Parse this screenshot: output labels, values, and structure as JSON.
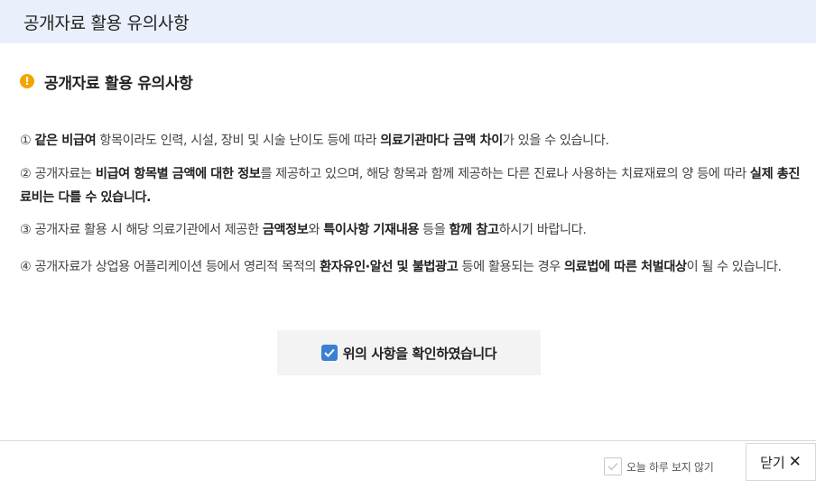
{
  "header": {
    "title": "공개자료 활용 유의사항"
  },
  "section": {
    "title": "공개자료 활용 유의사항",
    "icon": "alert-icon"
  },
  "notices": [
    {
      "marker": "①",
      "parts": [
        {
          "t": " "
        },
        {
          "t": "같은 비급여",
          "b": true
        },
        {
          "t": " 항목이라도 인력, 시설, 장비 및 시술 난이도 등에 따라 "
        },
        {
          "t": "의료기관마다 금액 차이",
          "b": true
        },
        {
          "t": "가 있을 수 있습니다."
        }
      ]
    },
    {
      "marker": "②",
      "parts": [
        {
          "t": " 공개자료는 "
        },
        {
          "t": "비급여 항목별 금액에 대한 정보",
          "b": true
        },
        {
          "t": "를 제공하고 있으며, 해당 항목과 함께 제공하는 다른 진료나 사용하는 치료재료의 양 등에 따라 "
        },
        {
          "t": "실제 총진료비는 다를 수 있습니다.",
          "b": true
        }
      ]
    },
    {
      "marker": "③",
      "parts": [
        {
          "t": " 공개자료 활용 시 해당 의료기관에서 제공한 "
        },
        {
          "t": "금액정보",
          "b": true
        },
        {
          "t": "와 "
        },
        {
          "t": "특이사항 기재내용",
          "b": true
        },
        {
          "t": " 등을 "
        },
        {
          "t": "함께 참고",
          "b": true
        },
        {
          "t": "하시기 바랍니다."
        }
      ]
    },
    {
      "marker": "④",
      "parts": [
        {
          "t": " 공개자료가 상업용 어플리케이션 등에서 영리적 목적의 "
        },
        {
          "t": "환자유인·알선 및 불법광고",
          "b": true
        },
        {
          "t": " 등에 활용되는 경우 "
        },
        {
          "t": "의료법에 따른 처벌대상",
          "b": true
        },
        {
          "t": "이 될 수 있습니다."
        }
      ]
    }
  ],
  "confirm": {
    "label": "위의 사항을 확인하였습니다",
    "checked": true,
    "color": "#3b7fd4"
  },
  "footer": {
    "dont_show_label": "오늘 하루 보지 않기",
    "dont_show_checked": false,
    "close_label": "닫기"
  },
  "colors": {
    "header_bg": "#e9f0fb",
    "accent": "#3b7fd4",
    "alert": "#f4a300"
  }
}
